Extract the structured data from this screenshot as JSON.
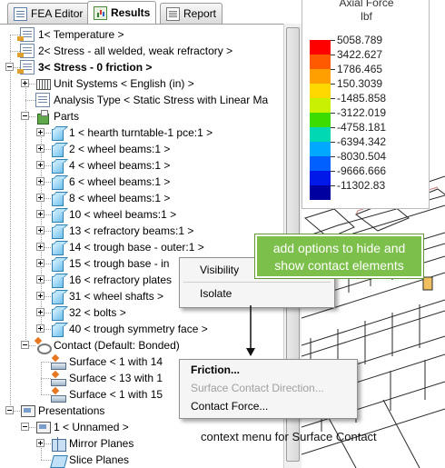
{
  "tabs": [
    {
      "label": "FEA Editor",
      "icon": "fea-editor-icon"
    },
    {
      "label": "Results",
      "icon": "results-icon",
      "active": true
    },
    {
      "label": "Report",
      "icon": "report-icon"
    }
  ],
  "tree": {
    "items": [
      {
        "label": "1< Temperature >",
        "icon": "step-icon"
      },
      {
        "label": "2< Stress - all welded, weak refractory >",
        "icon": "step-icon"
      },
      {
        "label": "3< Stress - 0 friction >",
        "icon": "step-icon",
        "bold": true
      },
      {
        "label": "Unit Systems < English (in) >",
        "icon": "unit-system-icon"
      },
      {
        "label": "Analysis Type < Static Stress with Linear Ma",
        "icon": "analysis-type-icon"
      },
      {
        "label": "Parts",
        "icon": "parts-icon"
      },
      {
        "label": "1 < hearth turntable-1 pce:1 >",
        "icon": "part-cube-icon"
      },
      {
        "label": "2 < wheel beams:1 >",
        "icon": "part-cube-icon"
      },
      {
        "label": "4 < wheel beams:1 >",
        "icon": "part-cube-icon"
      },
      {
        "label": "6 < wheel beams:1 >",
        "icon": "part-cube-icon"
      },
      {
        "label": "8 < wheel beams:1 >",
        "icon": "part-cube-icon"
      },
      {
        "label": "10 < wheel beams:1 >",
        "icon": "part-cube-icon"
      },
      {
        "label": "13 < refractory beams:1 >",
        "icon": "part-cube-icon"
      },
      {
        "label": "14 < trough base - outer:1 >",
        "icon": "part-cube-icon"
      },
      {
        "label": "15 < trough base - in",
        "icon": "part-cube-icon"
      },
      {
        "label": "16 < refractory plates",
        "icon": "part-cube-icon"
      },
      {
        "label": "31 < wheel shafts >",
        "icon": "part-cube-icon"
      },
      {
        "label": "32 < bolts >",
        "icon": "part-cube-icon"
      },
      {
        "label": "40 < trough symmetry face >",
        "icon": "part-cube-icon"
      },
      {
        "label": "Contact (Default: Bonded)",
        "icon": "contact-icon"
      },
      {
        "label": "Surface < 1 with 14",
        "icon": "surface-contact-icon"
      },
      {
        "label": "Surface < 13 with 1",
        "icon": "surface-contact-icon"
      },
      {
        "label": "Surface < 1 with 15",
        "icon": "surface-contact-icon"
      },
      {
        "label": "Presentations",
        "icon": "presentations-icon"
      },
      {
        "label": "1 < Unnamed >",
        "icon": "presentation-icon"
      },
      {
        "label": "Mirror Planes",
        "icon": "mirror-planes-icon"
      },
      {
        "label": "Slice Planes",
        "icon": "slice-planes-icon"
      }
    ]
  },
  "legend": {
    "title": "Axial Force",
    "unit": "lbf",
    "values": [
      "5058.789",
      "3422.627",
      "1786.465",
      "150.3039",
      "-1485.858",
      "-3122.019",
      "-4758.181",
      "-6394.342",
      "-8030.504",
      "-9666.666",
      "-11302.83"
    ],
    "colors": [
      "#ff0000",
      "#ff5a00",
      "#ffa000",
      "#ffd800",
      "#c8f000",
      "#3cdc00",
      "#00d8b4",
      "#00a8ff",
      "#0060ff",
      "#0018e8",
      "#0000a0"
    ]
  },
  "menu1": {
    "items": [
      {
        "label": "Visibility",
        "disabled": false
      },
      {
        "label": "Isolate",
        "disabled": false
      }
    ]
  },
  "menu2": {
    "items": [
      {
        "label": "Friction...",
        "disabled": false
      },
      {
        "label": "Surface Contact Direction...",
        "disabled": true
      },
      {
        "label": "Contact Force...",
        "disabled": false
      }
    ]
  },
  "callout": {
    "line1": "add options to hide and",
    "line2": "show contact elements"
  },
  "caption": "context menu for Surface Contact",
  "colors": {
    "callout_green": "#7cbf4a",
    "menu_background": "#f5f5f5",
    "legend_max": "#ff0000",
    "legend_min": "#0000a0"
  }
}
